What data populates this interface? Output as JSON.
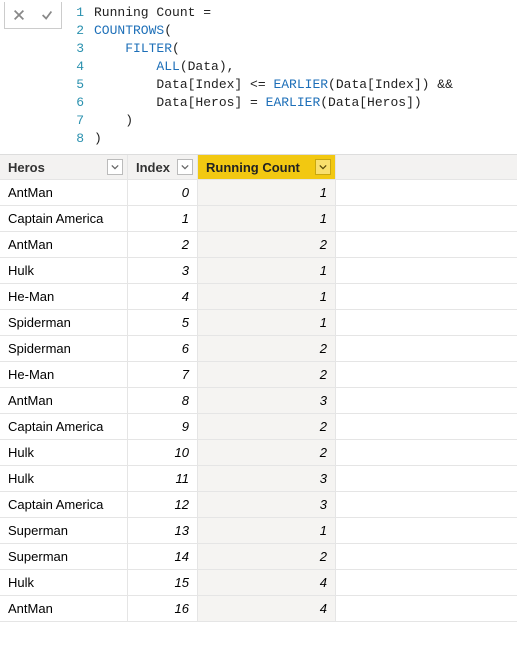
{
  "formula": {
    "lines": [
      {
        "n": "1",
        "segments": [
          {
            "t": "Running Count =",
            "c": "plain"
          }
        ]
      },
      {
        "n": "2",
        "segments": [
          {
            "t": "COUNTROWS",
            "c": "fn"
          },
          {
            "t": "(",
            "c": "plain"
          }
        ]
      },
      {
        "n": "3",
        "segments": [
          {
            "t": "    ",
            "c": "plain"
          },
          {
            "t": "FILTER",
            "c": "fn"
          },
          {
            "t": "(",
            "c": "plain"
          }
        ]
      },
      {
        "n": "4",
        "segments": [
          {
            "t": "        ",
            "c": "plain"
          },
          {
            "t": "ALL",
            "c": "fn"
          },
          {
            "t": "(Data),",
            "c": "plain"
          }
        ]
      },
      {
        "n": "5",
        "segments": [
          {
            "t": "        Data[Index] <= ",
            "c": "plain"
          },
          {
            "t": "EARLIER",
            "c": "fn"
          },
          {
            "t": "(Data[Index]) &&",
            "c": "plain"
          }
        ]
      },
      {
        "n": "6",
        "segments": [
          {
            "t": "        Data[Heros] = ",
            "c": "plain"
          },
          {
            "t": "EARLIER",
            "c": "fn"
          },
          {
            "t": "(Data[Heros])",
            "c": "plain"
          }
        ]
      },
      {
        "n": "7",
        "segments": [
          {
            "t": "    )",
            "c": "plain"
          }
        ]
      },
      {
        "n": "8",
        "segments": [
          {
            "t": ")",
            "c": "plain"
          }
        ]
      }
    ]
  },
  "grid": {
    "columns": {
      "heros": "Heros",
      "index": "Index",
      "running_count": "Running Count"
    },
    "rows": [
      {
        "heros": "AntMan",
        "index": "0",
        "rc": "1"
      },
      {
        "heros": "Captain America",
        "index": "1",
        "rc": "1"
      },
      {
        "heros": "AntMan",
        "index": "2",
        "rc": "2"
      },
      {
        "heros": "Hulk",
        "index": "3",
        "rc": "1"
      },
      {
        "heros": "He-Man",
        "index": "4",
        "rc": "1"
      },
      {
        "heros": "Spiderman",
        "index": "5",
        "rc": "1"
      },
      {
        "heros": "Spiderman",
        "index": "6",
        "rc": "2"
      },
      {
        "heros": "He-Man",
        "index": "7",
        "rc": "2"
      },
      {
        "heros": "AntMan",
        "index": "8",
        "rc": "3"
      },
      {
        "heros": "Captain America",
        "index": "9",
        "rc": "2"
      },
      {
        "heros": "Hulk",
        "index": "10",
        "rc": "2"
      },
      {
        "heros": "Hulk",
        "index": "11",
        "rc": "3"
      },
      {
        "heros": "Captain America",
        "index": "12",
        "rc": "3"
      },
      {
        "heros": "Superman",
        "index": "13",
        "rc": "1"
      },
      {
        "heros": "Superman",
        "index": "14",
        "rc": "2"
      },
      {
        "heros": "Hulk",
        "index": "15",
        "rc": "4"
      },
      {
        "heros": "AntMan",
        "index": "16",
        "rc": "4"
      }
    ]
  }
}
